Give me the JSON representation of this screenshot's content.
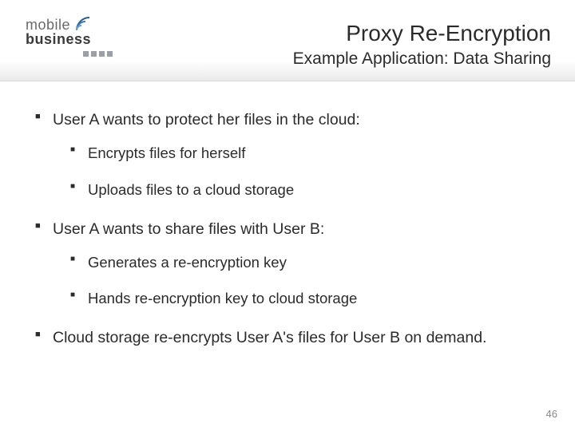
{
  "logo": {
    "word1": "mobile",
    "word2": "business"
  },
  "header": {
    "title": "Proxy Re-Encryption",
    "subtitle": "Example Application: Data Sharing"
  },
  "bullets": {
    "items": [
      {
        "text": "User A wants to protect her files in the cloud:",
        "sub": [
          "Encrypts files for herself",
          "Uploads files to a cloud storage"
        ]
      },
      {
        "text": "User A wants to share files with User B:",
        "sub": [
          "Generates a re-encryption key",
          "Hands re-encryption key to cloud storage"
        ]
      },
      {
        "text": "Cloud storage re-encrypts User A's files for User B on demand.",
        "sub": []
      }
    ]
  },
  "page_number": "46"
}
